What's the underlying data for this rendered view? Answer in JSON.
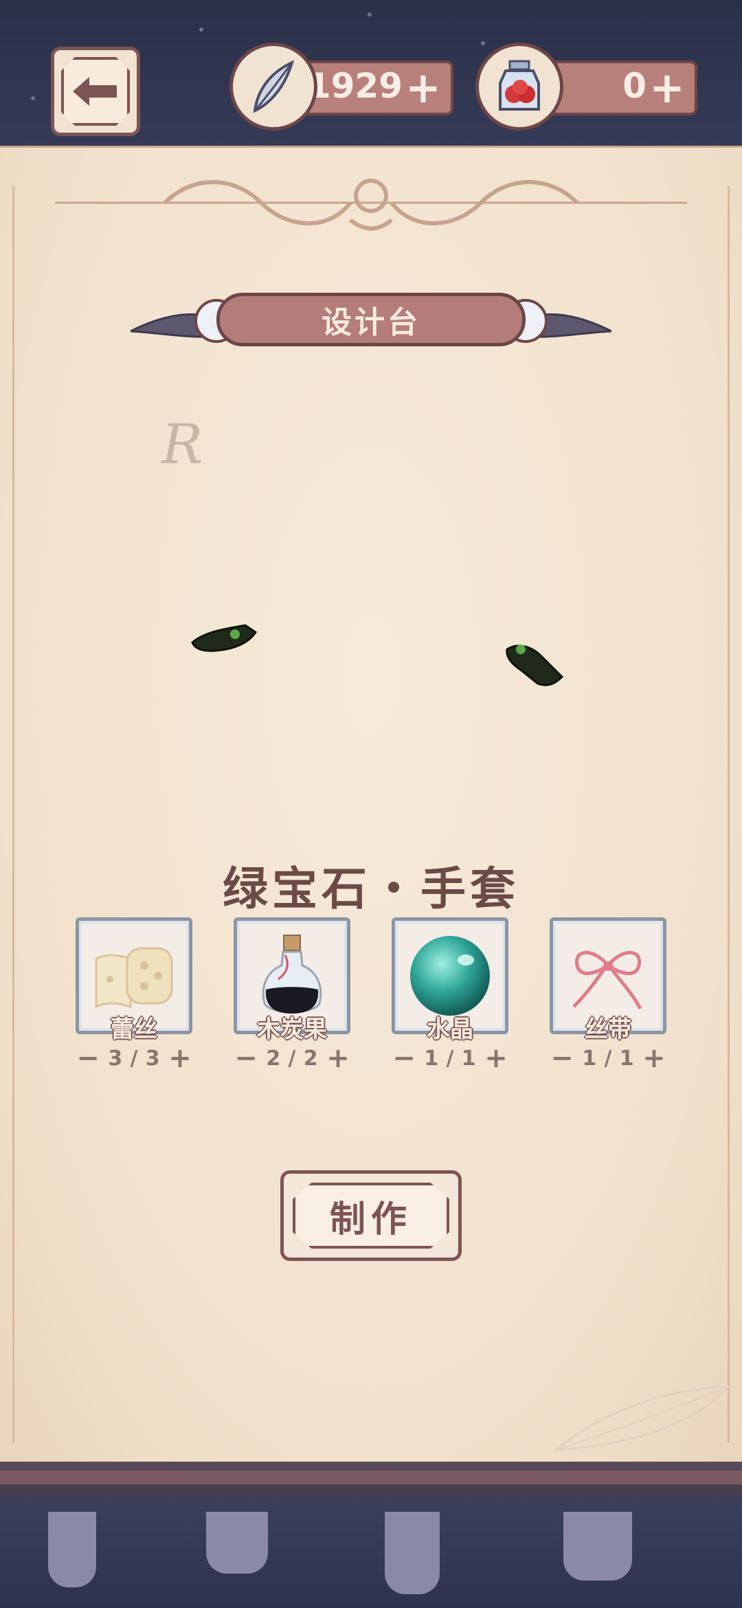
{
  "header": {
    "quill_count": "1929",
    "jar_count": "0",
    "plus_label": "+"
  },
  "banner": {
    "title": "设计台"
  },
  "rune": "R",
  "item": {
    "name": "绿宝石・手套"
  },
  "materials": [
    {
      "name": "蕾丝",
      "have": "3",
      "need": "3",
      "minus": "−",
      "plus": "+"
    },
    {
      "name": "木炭果",
      "have": "2",
      "need": "2",
      "minus": "−",
      "plus": "+"
    },
    {
      "name": "水晶",
      "have": "1",
      "need": "1",
      "minus": "−",
      "plus": "+"
    },
    {
      "name": "丝带",
      "have": "1",
      "need": "1",
      "minus": "−",
      "plus": "+"
    }
  ],
  "action": {
    "make_label": "制作"
  },
  "colors": {
    "accent": "#b47d79",
    "outline": "#6d4647",
    "paper": "#f1e1cc",
    "frame": "#8a95a4"
  }
}
